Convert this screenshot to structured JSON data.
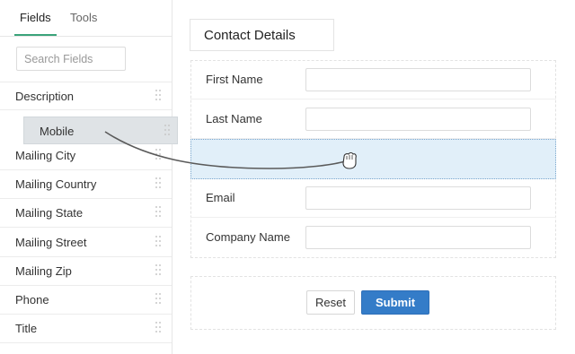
{
  "tabs": {
    "fields": "Fields",
    "tools": "Tools"
  },
  "search": {
    "placeholder": "Search Fields"
  },
  "fields": {
    "items": [
      {
        "label": "Description"
      },
      {
        "label": "Mailing City"
      },
      {
        "label": "Mailing Country"
      },
      {
        "label": "Mailing State"
      },
      {
        "label": "Mailing Street"
      },
      {
        "label": "Mailing Zip"
      },
      {
        "label": "Phone"
      },
      {
        "label": "Title"
      }
    ]
  },
  "drag": {
    "label": "Mobile",
    "cursor_icon": "grab-hand-icon"
  },
  "form": {
    "section_title": "Contact Details",
    "fields": [
      {
        "label": "First Name",
        "value": ""
      },
      {
        "label": "Last Name",
        "value": ""
      },
      {
        "label": "Email",
        "value": ""
      },
      {
        "label": "Company Name",
        "value": ""
      }
    ],
    "reset_label": "Reset",
    "submit_label": "Submit"
  },
  "colors": {
    "tab_accent": "#3aa37a",
    "submit": "#347cc8",
    "drop_zone": "#e1eff9"
  }
}
